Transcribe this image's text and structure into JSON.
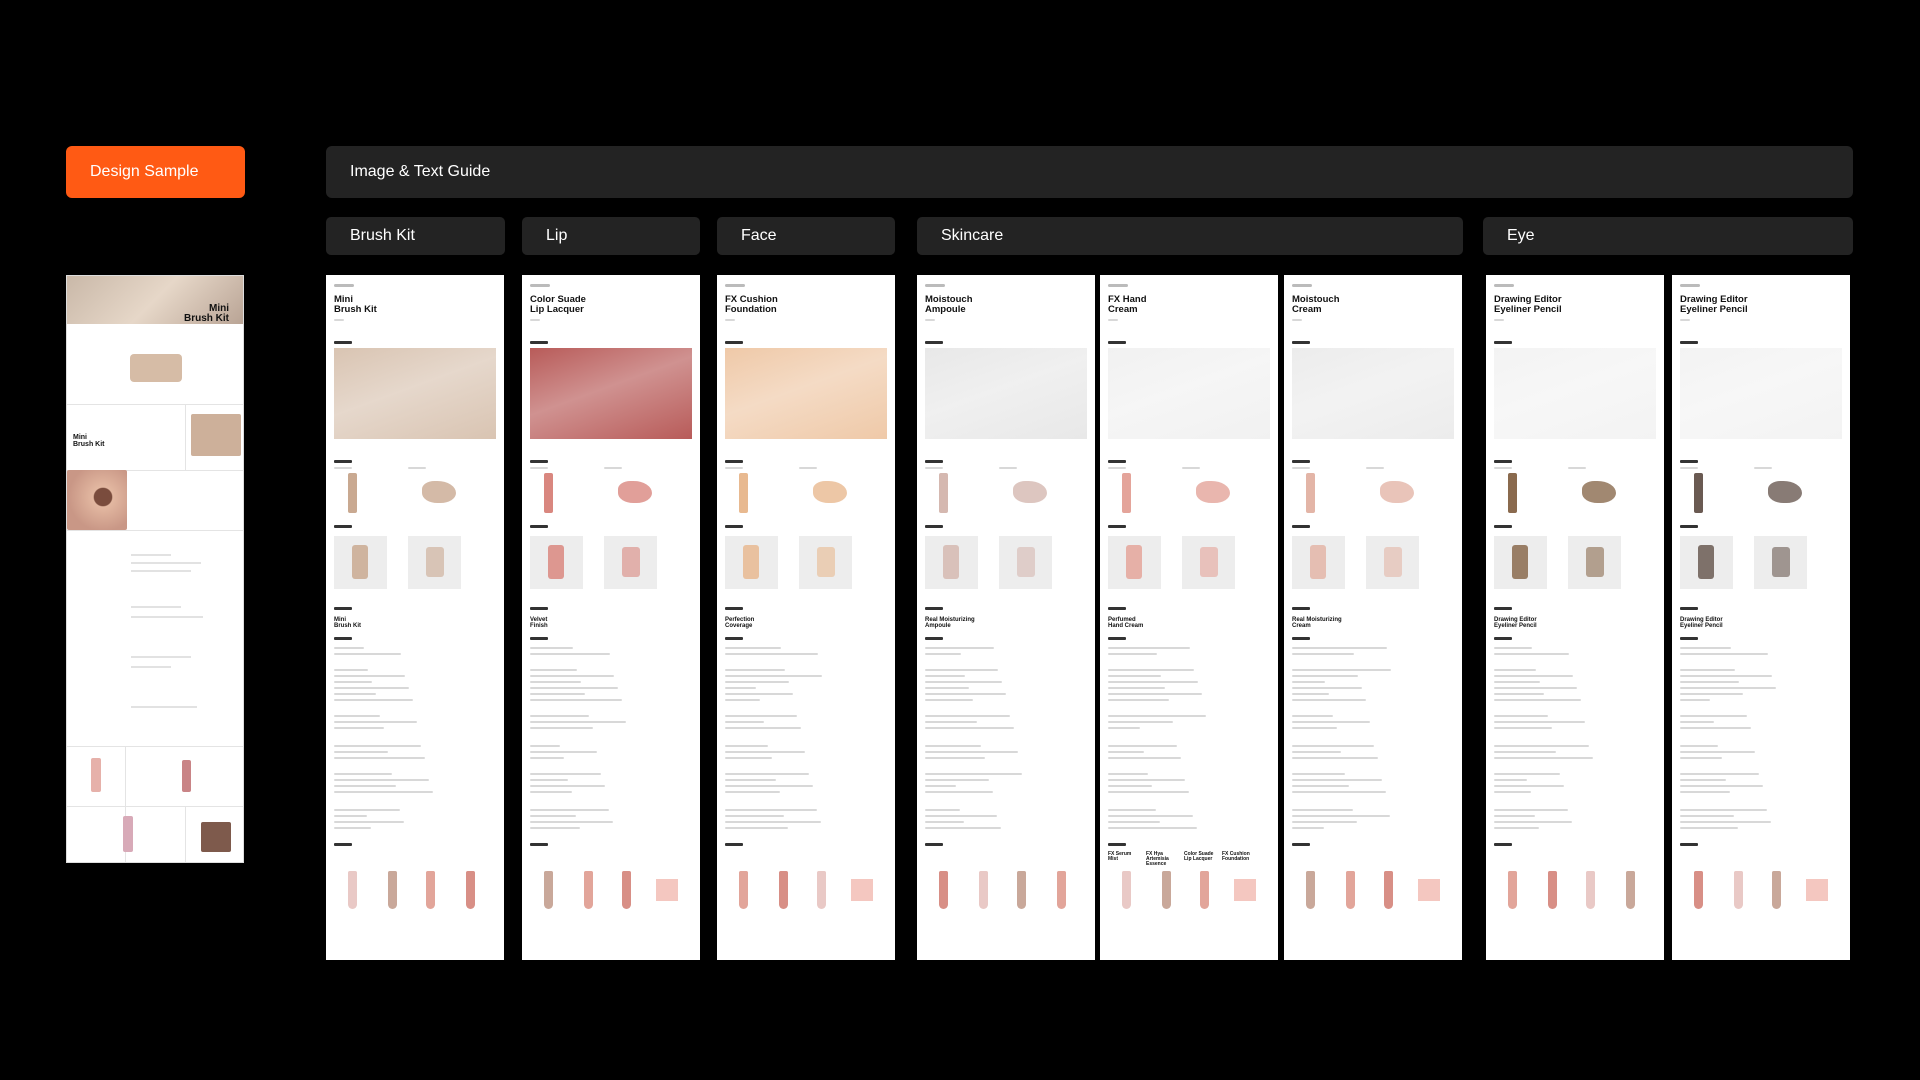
{
  "sample_button": "Design Sample",
  "guide_title": "Image & Text Guide",
  "tabs": [
    "Brush Kit",
    "Lip",
    "Face",
    "Skincare",
    "Eye"
  ],
  "sample_preview": {
    "hero_title": "Mini\nBrush Kit",
    "section_title": "Mini\nBrush Kit"
  },
  "pages": [
    {
      "title": "Mini\nBrush Kit",
      "subtitle": "Mini\nBrush Kit",
      "hero_color": "#d9c4b2",
      "accent": "#c9a991"
    },
    {
      "title": "Color Suade\nLip Lacquer",
      "subtitle": "Velvet\nFinish",
      "hero_color": "#b85b59",
      "accent": "#d9877f"
    },
    {
      "title": "FX Cushion\nFoundation",
      "subtitle": "Perfection\nCoverage",
      "hero_color": "#efc9a8",
      "accent": "#e8b990"
    },
    {
      "title": "Moistouch\nAmpoule",
      "subtitle": "Real Moisturizing\nAmpoule",
      "hero_color": "#e8e8e8",
      "accent": "#d5b8b0"
    },
    {
      "title": "FX Hand\nCream",
      "subtitle": "Perfumed\nHand Cream",
      "hero_color": "#f1f1f1",
      "accent": "#e4a49a"
    },
    {
      "title": "Moistouch\nCream",
      "subtitle": "Real Moisturizing\nCream",
      "hero_color": "#ececec",
      "accent": "#e3b5a7"
    },
    {
      "title": "Drawing Editor\nEyeliner Pencil",
      "subtitle": "Drawing Editor\nEyeliner Pencil",
      "hero_color": "#f3f3f3",
      "accent": "#8a6a4e"
    },
    {
      "title": "Drawing Editor\nEyeliner Pencil",
      "subtitle": "Drawing Editor\nEyeliner Pencil",
      "hero_color": "#f3f3f3",
      "accent": "#6a5a52"
    }
  ],
  "related_labels": [
    "FX Serum\nMist",
    "FX Hya Artemisia\nEssence",
    "Color Suade\nLip Lacquer",
    "FX Cushion\nFoundation"
  ]
}
